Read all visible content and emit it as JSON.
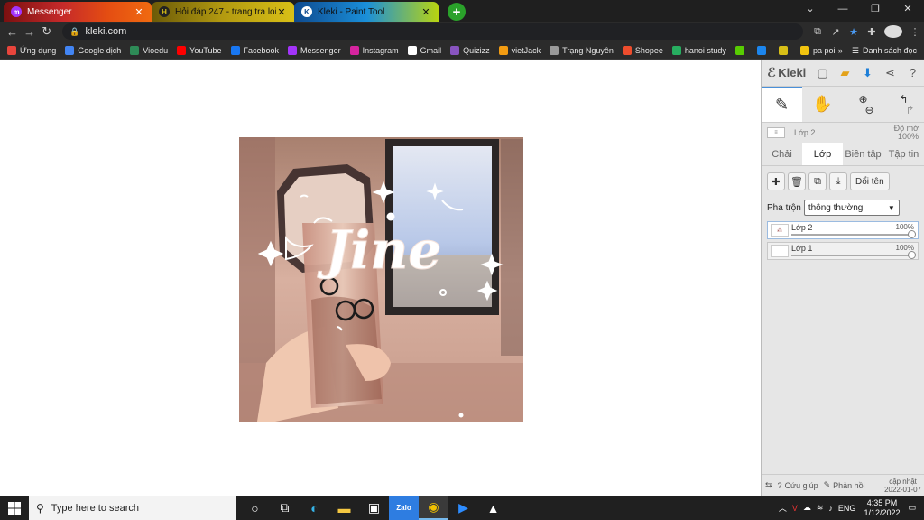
{
  "browser": {
    "tabs": [
      {
        "title": "Messenger",
        "icon": "messenger-icon",
        "active": false
      },
      {
        "title": "Hỏi đáp 247 - trang tra loi",
        "icon": "h-icon",
        "active": false
      },
      {
        "title": "Kleki - Paint Tool",
        "icon": "kleki-icon",
        "active": true
      }
    ],
    "new_tab": "+",
    "url": "kleki.com",
    "bookmarks": [
      {
        "label": "Ứng dụng",
        "icon": "apps-icon",
        "color": "#e8453c"
      },
      {
        "label": "Google dịch",
        "icon": "translate-icon",
        "color": "#4285f4"
      },
      {
        "label": "Vioedu",
        "icon": "vioedu-icon",
        "color": "#2e8b57"
      },
      {
        "label": "YouTube",
        "icon": "youtube-icon",
        "color": "#ff0000"
      },
      {
        "label": "Facebook",
        "icon": "facebook-icon",
        "color": "#1877f2"
      },
      {
        "label": "Messenger",
        "icon": "messenger-icon",
        "color": "#a334fa"
      },
      {
        "label": "Instagram",
        "icon": "instagram-icon",
        "color": "#d6249f"
      },
      {
        "label": "Gmail",
        "icon": "google-icon",
        "color": "#ffffff"
      },
      {
        "label": "Quizizz",
        "icon": "quizizz-icon",
        "color": "#8854c0"
      },
      {
        "label": "vietJack",
        "icon": "vietjack-icon",
        "color": "#f39c12"
      },
      {
        "label": "Trạng Nguyên",
        "icon": "bookmark-icon",
        "color": "#999999"
      },
      {
        "label": "Shopee",
        "icon": "shopee-icon",
        "color": "#ee4d2d"
      },
      {
        "label": "hanoi study",
        "icon": "hanoi-icon",
        "color": "#27ae60"
      },
      {
        "label": "",
        "icon": "duolingo-icon",
        "color": "#58cc02"
      },
      {
        "label": "",
        "icon": "l-icon",
        "color": "#1c86ee"
      },
      {
        "label": "",
        "icon": "h-icon",
        "color": "#d9c017"
      },
      {
        "label": "pa poi",
        "icon": "folder-icon",
        "color": "#f1c40f"
      }
    ],
    "bookmarks_more": "»",
    "reading_list": "Danh sách đọc"
  },
  "kleki": {
    "logo": "Kleki",
    "layer_name": "Lớp 2",
    "opacity_label": "Độ mờ",
    "opacity_value": "100%",
    "tabs": [
      "Chải",
      "Lớp",
      "Biên tập",
      "Tập tin"
    ],
    "active_tab": "Lớp",
    "rename_label": "Đổi tên",
    "blend_label": "Pha trộn",
    "blend_value": "thông thường",
    "layers": [
      {
        "name": "Lớp 2",
        "opacity": "100%",
        "selected": true
      },
      {
        "name": "Lớp 1",
        "opacity": "100%",
        "selected": false
      }
    ],
    "footer": {
      "help": "Cứu giúp",
      "feedback": "Phản hồi",
      "version_label": "cập nhật",
      "version_date": "2022-01-07"
    }
  },
  "artwork": {
    "text": "Jine"
  },
  "taskbar": {
    "search_placeholder": "Type here to search",
    "language": "ENG",
    "time": "4:35 PM",
    "date": "1/12/2022"
  }
}
